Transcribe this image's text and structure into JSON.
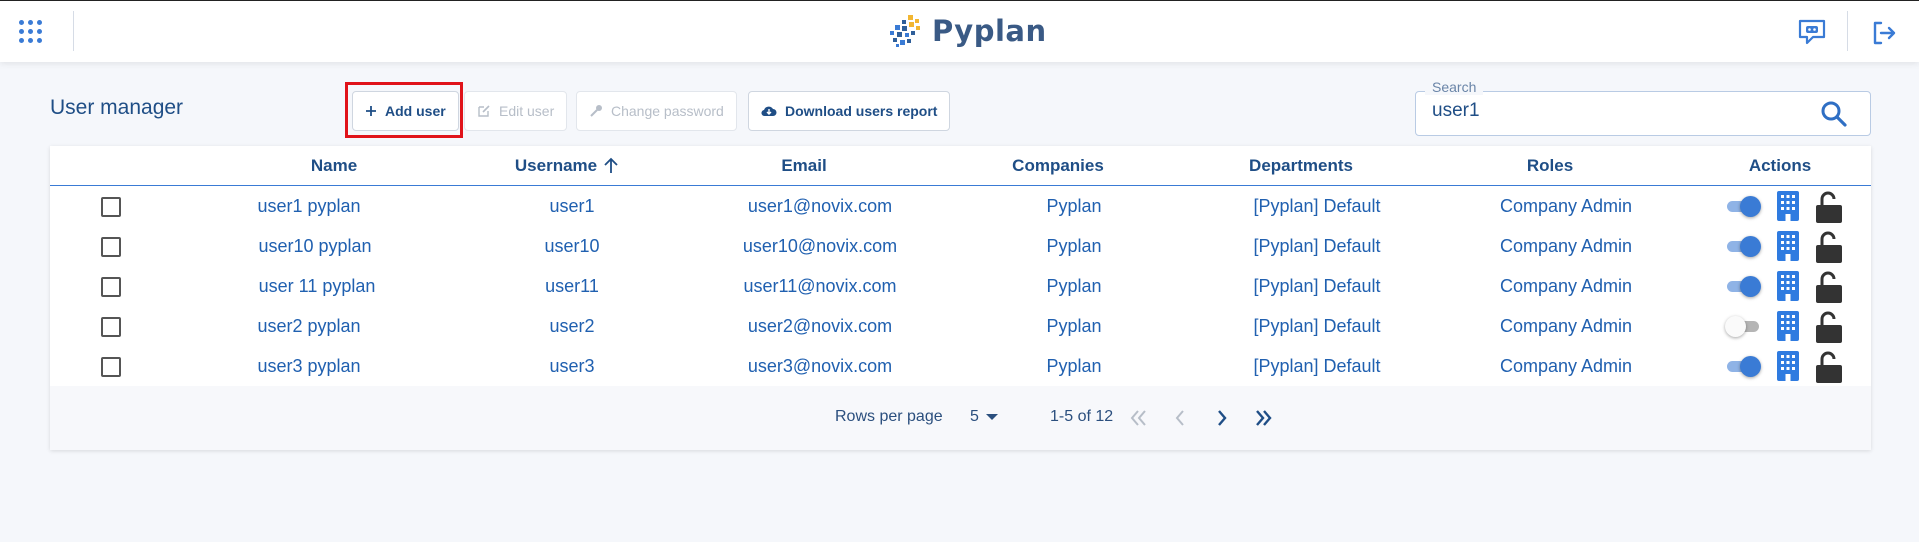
{
  "app": {
    "logo_text": "Pyplan"
  },
  "topbar": {
    "apps_icon": "grid-dots-icon",
    "assistant_icon": "assistant-chat-icon",
    "logout_icon": "logout-icon"
  },
  "page": {
    "title": "User manager"
  },
  "toolbar": {
    "add_user": "Add user",
    "edit_user": "Edit user",
    "change_password": "Change password",
    "download_report": "Download users report"
  },
  "search": {
    "label": "Search",
    "value": "user1"
  },
  "table": {
    "headers": {
      "name": "Name",
      "username": "Username",
      "email": "Email",
      "companies": "Companies",
      "departments": "Departments",
      "roles": "Roles",
      "actions": "Actions"
    },
    "sort": {
      "column": "username",
      "direction": "ascending"
    },
    "rows": [
      {
        "name": "user1 pyplan",
        "username": "user1",
        "email": "user1@novix.com",
        "company": "Pyplan",
        "department": "[Pyplan] Default",
        "role": "Company Admin",
        "active": true
      },
      {
        "name": "user10 pyplan",
        "username": "user10",
        "email": "user10@novix.com",
        "company": "Pyplan",
        "department": "[Pyplan] Default",
        "role": "Company Admin",
        "active": true
      },
      {
        "name": "user 11 pyplan",
        "username": "user11",
        "email": "user11@novix.com",
        "company": "Pyplan",
        "department": "[Pyplan] Default",
        "role": "Company Admin",
        "active": true
      },
      {
        "name": "user2 pyplan",
        "username": "user2",
        "email": "user2@novix.com",
        "company": "Pyplan",
        "department": "[Pyplan] Default",
        "role": "Company Admin",
        "active": false
      },
      {
        "name": "user3 pyplan",
        "username": "user3",
        "email": "user3@novix.com",
        "company": "Pyplan",
        "department": "[Pyplan] Default",
        "role": "Company Admin",
        "active": true
      }
    ]
  },
  "pagination": {
    "rows_per_page_label": "Rows per page",
    "rows_per_page": "5",
    "range": "1-5 of 12"
  },
  "colors": {
    "accent": "#3a7bd5",
    "text": "#1f4e86",
    "highlight": "#e0131a",
    "toggle_on": "#3a7bd5",
    "toggle_off": "#b5b5b5"
  }
}
